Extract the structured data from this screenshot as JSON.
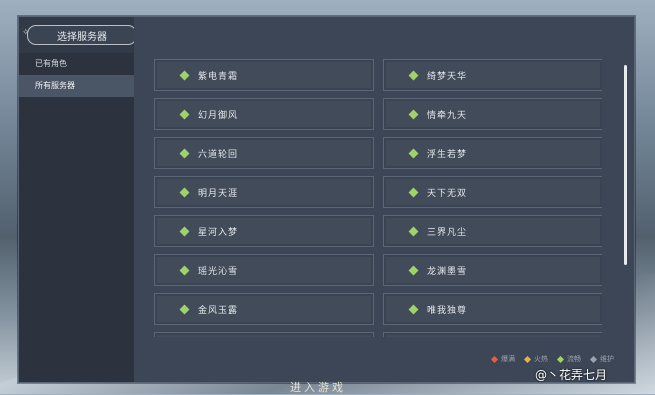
{
  "dialog": {
    "title": "选择服务器",
    "close_glyph": "×"
  },
  "sidebar": {
    "items": [
      {
        "label": "已有角色"
      },
      {
        "label": "所有服务器"
      }
    ]
  },
  "servers": [
    {
      "name": "紫电青霜",
      "status": "流畅"
    },
    {
      "name": "绮梦天华",
      "status": "流畅"
    },
    {
      "name": "幻月御风",
      "status": "流畅"
    },
    {
      "name": "情牵九天",
      "status": "流畅"
    },
    {
      "name": "六道轮回",
      "status": "流畅"
    },
    {
      "name": "浮生若梦",
      "status": "流畅"
    },
    {
      "name": "明月天涯",
      "status": "流畅"
    },
    {
      "name": "天下无双",
      "status": "流畅"
    },
    {
      "name": "星河入梦",
      "status": "流畅"
    },
    {
      "name": "三界凡尘",
      "status": "流畅"
    },
    {
      "name": "瑶光沁雪",
      "status": "流畅"
    },
    {
      "name": "龙渊墨雪",
      "status": "流畅"
    },
    {
      "name": "金风玉露",
      "status": "流畅"
    },
    {
      "name": "唯我独尊",
      "status": "流畅"
    }
  ],
  "legend": [
    {
      "label": "爆满",
      "color": "#e0604a"
    },
    {
      "label": "火热",
      "color": "#e6b43a"
    },
    {
      "label": "流畅",
      "color": "#9fd36a"
    },
    {
      "label": "维护",
      "color": "#9aa3ad"
    }
  ],
  "footer": {
    "enter_game": "进入游戏"
  },
  "watermark": "@丶花弄七月"
}
